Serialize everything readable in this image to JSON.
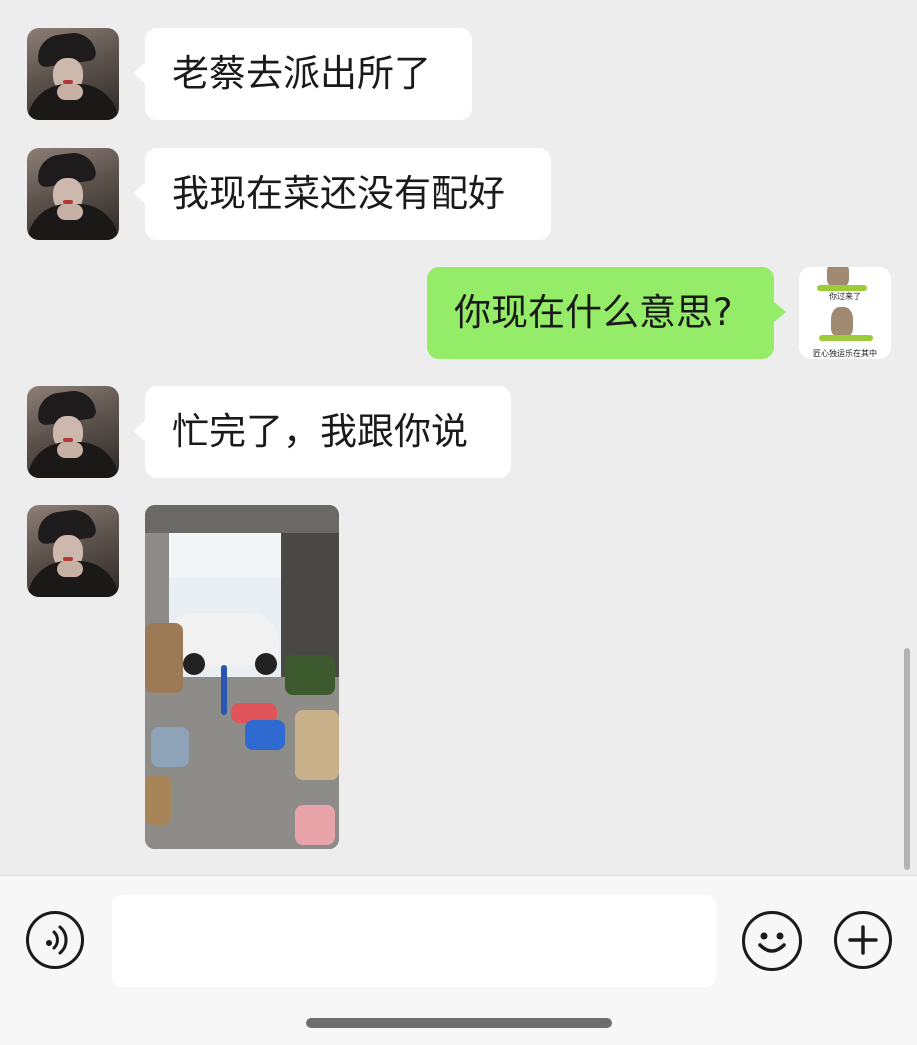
{
  "messages": [
    {
      "side": "in",
      "type": "text",
      "text": "老蔡去派出所了"
    },
    {
      "side": "in",
      "type": "text",
      "text": "我现在菜还没有配好"
    },
    {
      "side": "out",
      "type": "text",
      "text": "你现在什么意思?",
      "sticker": {
        "icon": "donkey-sticker-icon",
        "top_caption": "你过来了",
        "bottom_caption": "匠心独运乐在其中"
      }
    },
    {
      "side": "in",
      "type": "text",
      "text": "忙完了，我跟你说"
    },
    {
      "side": "in",
      "type": "image",
      "icon": "warehouse-photo-thumbnail"
    }
  ],
  "input_bar": {
    "voice_icon": "voice-icon",
    "emoji_icon": "emoji-icon",
    "plus_icon": "plus-icon",
    "input_value": "",
    "input_placeholder": ""
  },
  "colors": {
    "background": "#ededed",
    "incoming_bubble": "#ffffff",
    "outgoing_bubble": "#95ec69",
    "input_bar": "#f7f7f7"
  }
}
